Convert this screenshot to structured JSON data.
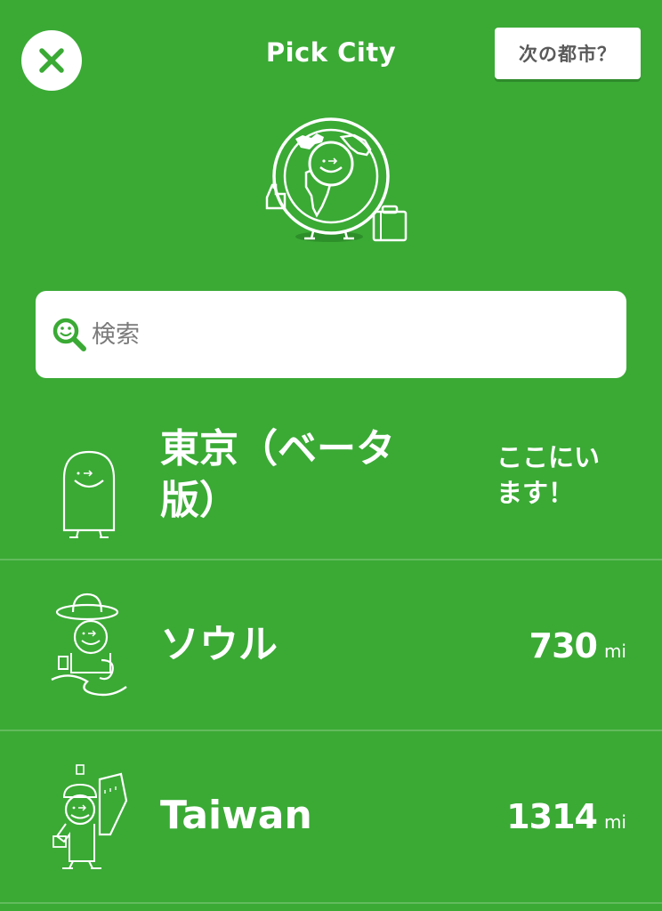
{
  "header": {
    "title": "Pick City",
    "next_city_label": "次の都市？"
  },
  "search": {
    "placeholder": "検索"
  },
  "cities": [
    {
      "name": "東京（ベータ版）",
      "status": "ここにいます！",
      "icon": "tokyo-mascot-icon"
    },
    {
      "name": "ソウル",
      "distance": "730",
      "unit": "mi",
      "icon": "seoul-mascot-icon"
    },
    {
      "name": "Taiwan",
      "distance": "1314",
      "unit": "mi",
      "icon": "taiwan-mascot-icon"
    }
  ],
  "colors": {
    "background": "#3aaa35",
    "accent": "#3aaa35",
    "divider": "#63bb5d",
    "button_text": "#5a5a5a"
  }
}
